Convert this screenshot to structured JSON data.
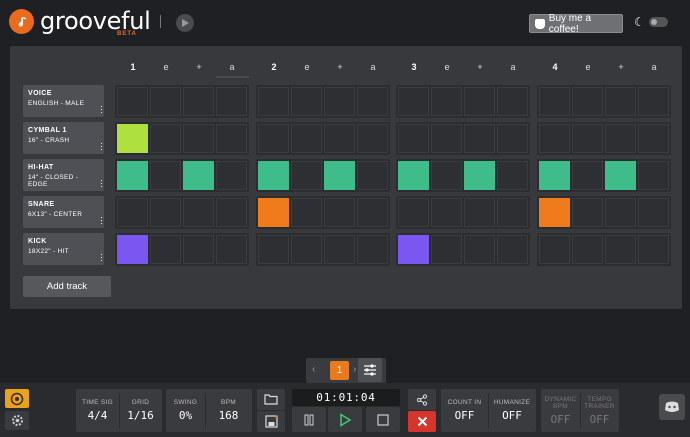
{
  "header": {
    "app_name": "grooveful",
    "beta": "BETA",
    "coffee_label": "Buy me a coffee!"
  },
  "beats": [
    "1",
    "e",
    "+",
    "a",
    "2",
    "e",
    "+",
    "a",
    "3",
    "e",
    "+",
    "a",
    "4",
    "e",
    "+",
    "a"
  ],
  "tracks": [
    {
      "name": "VOICE",
      "sub": "ENGLISH - MALE",
      "steps": [
        0,
        0,
        0,
        0,
        0,
        0,
        0,
        0,
        0,
        0,
        0,
        0,
        0,
        0,
        0,
        0
      ],
      "color": "#2e2f32"
    },
    {
      "name": "CYMBAL 1",
      "sub": "16\" - CRASH",
      "steps": [
        1,
        0,
        0,
        0,
        0,
        0,
        0,
        0,
        0,
        0,
        0,
        0,
        0,
        0,
        0,
        0
      ],
      "color": "#aee03f"
    },
    {
      "name": "HI-HAT",
      "sub": "14\" - CLOSED - EDGE",
      "steps": [
        1,
        0,
        1,
        0,
        1,
        0,
        1,
        0,
        1,
        0,
        1,
        0,
        1,
        0,
        1,
        0
      ],
      "color": "#3ebd8a"
    },
    {
      "name": "SNARE",
      "sub": "6X13\" - CENTER",
      "steps": [
        0,
        0,
        0,
        0,
        1,
        0,
        0,
        0,
        0,
        0,
        0,
        0,
        1,
        0,
        0,
        0
      ],
      "color": "#f07b1a"
    },
    {
      "name": "KICK",
      "sub": "18X22\" - HIT",
      "steps": [
        1,
        0,
        0,
        0,
        0,
        0,
        0,
        0,
        1,
        0,
        0,
        0,
        0,
        0,
        0,
        0
      ],
      "color": "#7a57f0"
    }
  ],
  "add_track_label": "Add track",
  "pager": {
    "prev": "‹",
    "page": "1",
    "next": "›"
  },
  "controls": {
    "time_sig": {
      "label": "TIME SIG",
      "value": "4/4"
    },
    "grid": {
      "label": "GRID",
      "value": "1/16"
    },
    "swing": {
      "label": "SWING",
      "value": "0%"
    },
    "bpm": {
      "label": "BPM",
      "value": "168"
    },
    "time": "01:01:04",
    "count_in": {
      "label": "COUNT IN",
      "value": "OFF"
    },
    "humanize": {
      "label": "HUMANIZE",
      "value": "OFF"
    },
    "dynamic_bpm": {
      "label1": "DYNAMIC",
      "label2": "BPM",
      "value": "OFF"
    },
    "tempo_trainer": {
      "label1": "TEMPO",
      "label2": "TRAINER",
      "value": "OFF"
    }
  },
  "colors": {
    "accent": "#ea7a1e",
    "panel": "#38393d",
    "background": "#1f2023"
  },
  "icons": [
    "logo-icon",
    "play-logo-icon",
    "coffee-cup-icon",
    "moon-icon",
    "sliders-icon",
    "drum-icon",
    "gear-icon",
    "folder-icon",
    "save-icon",
    "share-icon",
    "close-icon",
    "pause-icon",
    "play-icon",
    "stop-icon",
    "discord-icon"
  ]
}
